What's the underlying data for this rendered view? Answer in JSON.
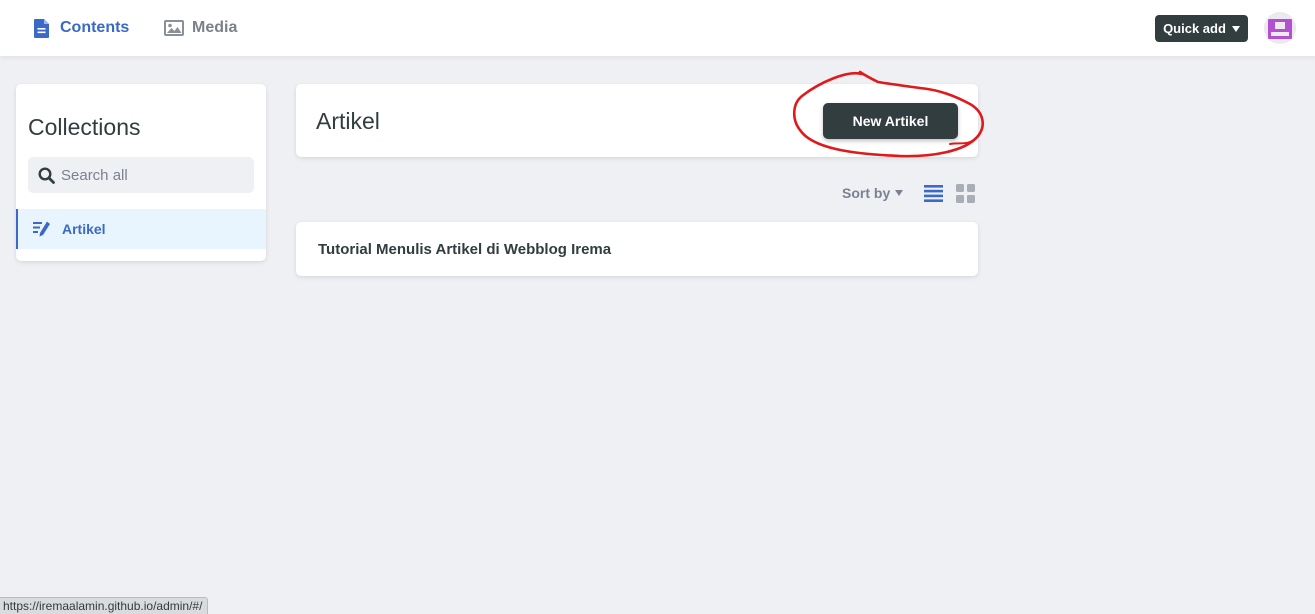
{
  "topbar": {
    "contents_label": "Contents",
    "media_label": "Media",
    "quick_add_label": "Quick add"
  },
  "sidebar": {
    "title": "Collections",
    "search_placeholder": "Search all",
    "items": [
      {
        "label": "Artikel",
        "active": true
      }
    ]
  },
  "main": {
    "collection_title": "Artikel",
    "new_button_label": "New Artikel",
    "sort_label": "Sort by",
    "view_modes": [
      "list",
      "grid"
    ],
    "active_view": "list",
    "entries": [
      {
        "title": "Tutorial Menulis Artikel di Webblog Irema"
      }
    ]
  },
  "status_bar": {
    "url": "https://iremaalamin.github.io/admin/#/"
  },
  "colors": {
    "accent": "#3a69c7",
    "dark_button": "#313d3e",
    "background": "#eff0f4",
    "annotation_red": "#e0191b"
  }
}
